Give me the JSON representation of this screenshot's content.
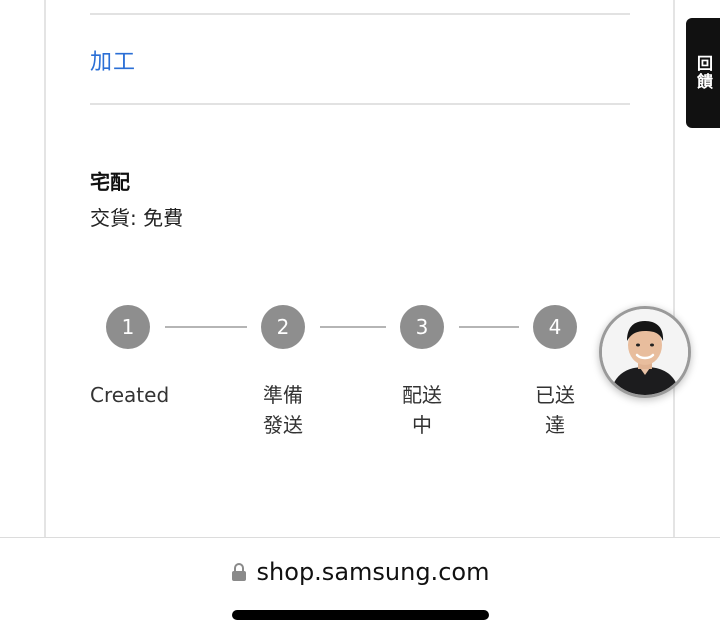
{
  "section": {
    "process_link": "加工",
    "delivery_title": "宅配",
    "delivery_fee": "交貨: 免費"
  },
  "steps": [
    {
      "number": "1",
      "label_line1": "Created",
      "label_line2": ""
    },
    {
      "number": "2",
      "label_line1": "準備",
      "label_line2": "發送"
    },
    {
      "number": "3",
      "label_line1": "配送",
      "label_line2": "中"
    },
    {
      "number": "4",
      "label_line1": "已送",
      "label_line2": "達"
    }
  ],
  "side_tab": {
    "label": "回饋"
  },
  "browser": {
    "url": "shop.samsung.com",
    "lock_icon": "lock-icon"
  },
  "colors": {
    "link": "#2b6fd6",
    "step_circle": "#8e8e8e",
    "step_line": "#b5b5b5"
  }
}
